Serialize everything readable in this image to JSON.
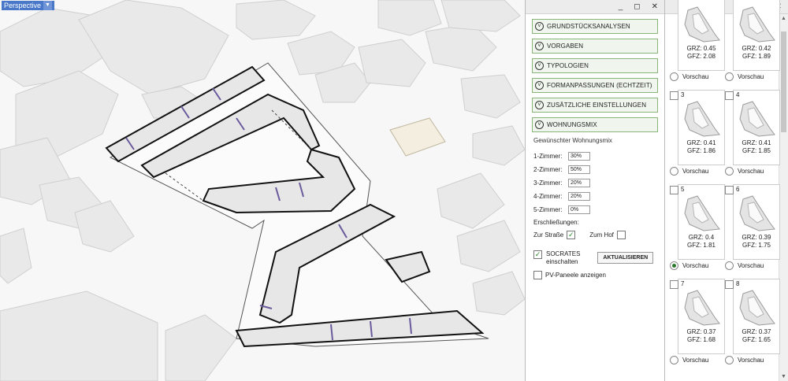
{
  "viewport": {
    "label": "Perspective",
    "dropdown_glyph": "▼"
  },
  "panel": {
    "window_controls": [
      "_",
      "◻",
      "✕"
    ],
    "sections": [
      {
        "label": "GRUNDSTÜCKSANALYSEN"
      },
      {
        "label": "VORGABEN"
      },
      {
        "label": "TYPOLOGIEN"
      },
      {
        "label": "FORMANPASSUNGEN (ECHTZEIT)"
      },
      {
        "label": "ZUSÄTZLICHE EINSTELLUNGEN"
      },
      {
        "label": "WOHNUNGSMIX"
      }
    ],
    "wohnungsmix": {
      "title": "Gewünschter Wohnungsmix",
      "rows": [
        {
          "label": "1-Zimmer:",
          "value": "30%"
        },
        {
          "label": "2-Zimmer:",
          "value": "50%"
        },
        {
          "label": "3-Zimmer:",
          "value": "20%"
        },
        {
          "label": "4-Zimmer:",
          "value": "20%"
        },
        {
          "label": "5-Zimmer:",
          "value": "0%"
        }
      ],
      "erschliessungen_label": "Erschließungen:",
      "zur_strasse_label": "Zur Straße",
      "zur_strasse_checked": true,
      "zum_hof_label": "Zum Hof",
      "zum_hof_checked": false,
      "socrates_label_1": "SOCRATES",
      "socrates_label_2": "einschalten",
      "socrates_checked": true,
      "update_button": "AKTUALISIEREN",
      "pv_label": "PV-Paneele anzeigen",
      "pv_checked": false
    }
  },
  "variants": {
    "window_controls": [
      "_",
      "◻",
      "✕"
    ],
    "preview_label": "Vorschau",
    "cards": [
      {
        "number": "",
        "grz": "GRZ: 0.45",
        "gfz": "GFZ: 2.08",
        "selected": false
      },
      {
        "number": "",
        "grz": "GRZ: 0.42",
        "gfz": "GFZ: 1.89",
        "selected": false
      },
      {
        "number": "3",
        "grz": "GRZ: 0.41",
        "gfz": "GFZ: 1.86",
        "selected": false
      },
      {
        "number": "4",
        "grz": "GRZ: 0.41",
        "gfz": "GFZ: 1.85",
        "selected": false
      },
      {
        "number": "5",
        "grz": "GRZ: 0.4",
        "gfz": "GFZ: 1.81",
        "selected": true
      },
      {
        "number": "6",
        "grz": "GRZ: 0.39",
        "gfz": "GFZ: 1.75",
        "selected": false
      },
      {
        "number": "7",
        "grz": "GRZ: 0.37",
        "gfz": "GFZ: 1.68",
        "selected": false
      },
      {
        "number": "8",
        "grz": "GRZ: 0.37",
        "gfz": "GFZ: 1.65",
        "selected": false
      }
    ]
  }
}
